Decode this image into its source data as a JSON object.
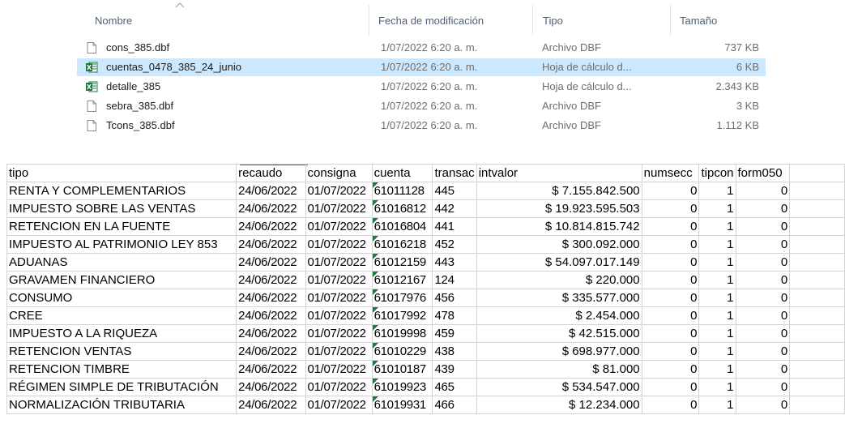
{
  "explorer": {
    "columns": {
      "name": "Nombre",
      "date": "Fecha de modificación",
      "type": "Tipo",
      "size": "Tamaño"
    },
    "files": [
      {
        "name": "cons_385.dbf",
        "date": "1/07/2022 6:20 a. m.",
        "type": "Archivo DBF",
        "size": "737 KB",
        "icon": "blank-file-icon"
      },
      {
        "name": "cuentas_0478_385_24_junio",
        "date": "1/07/2022 6:20 a. m.",
        "type": "Hoja de cálculo d...",
        "size": "6 KB",
        "icon": "excel-file-icon"
      },
      {
        "name": "detalle_385",
        "date": "1/07/2022 6:20 a. m.",
        "type": "Hoja de cálculo d...",
        "size": "2.343 KB",
        "icon": "excel-file-icon"
      },
      {
        "name": "sebra_385.dbf",
        "date": "1/07/2022 6:20 a. m.",
        "type": "Archivo DBF",
        "size": "3 KB",
        "icon": "blank-file-icon"
      },
      {
        "name": "Tcons_385.dbf",
        "date": "1/07/2022 6:20 a. m.",
        "type": "Archivo DBF",
        "size": "1.112 KB",
        "icon": "blank-file-icon"
      }
    ],
    "selected_index": 1
  },
  "sheet": {
    "headers": [
      "tipo",
      "recaudo",
      "consigna",
      "cuenta",
      "transac",
      "intvalor",
      "numsecc",
      "tipcon",
      "form050"
    ],
    "rows": [
      [
        "RENTA Y COMPLEMENTARIOS",
        "24/06/2022",
        "01/07/2022",
        "61011128",
        "445",
        "$ 7.155.842.500",
        "0",
        "1",
        "0"
      ],
      [
        "IMPUESTO SOBRE LAS VENTAS",
        "24/06/2022",
        "01/07/2022",
        "61016812",
        "442",
        "$ 19.923.595.503",
        "0",
        "1",
        "0"
      ],
      [
        "RETENCION EN LA FUENTE",
        "24/06/2022",
        "01/07/2022",
        "61016804",
        "441",
        "$ 10.814.815.742",
        "0",
        "1",
        "0"
      ],
      [
        "IMPUESTO AL PATRIMONIO LEY 853",
        "24/06/2022",
        "01/07/2022",
        "61016218",
        "452",
        "$ 300.092.000",
        "0",
        "1",
        "0"
      ],
      [
        "ADUANAS",
        "24/06/2022",
        "01/07/2022",
        "61012159",
        "443",
        "$ 54.097.017.149",
        "0",
        "1",
        "0"
      ],
      [
        "GRAVAMEN FINANCIERO",
        "24/06/2022",
        "01/07/2022",
        "61012167",
        "124",
        "$ 220.000",
        "0",
        "1",
        "0"
      ],
      [
        "CONSUMO",
        "24/06/2022",
        "01/07/2022",
        "61017976",
        "456",
        "$ 335.577.000",
        "0",
        "1",
        "0"
      ],
      [
        "CREE",
        "24/06/2022",
        "01/07/2022",
        "61017992",
        "478",
        "$ 2.454.000",
        "0",
        "1",
        "0"
      ],
      [
        "IMPUESTO A LA RIQUEZA",
        "24/06/2022",
        "01/07/2022",
        "61019998",
        "459",
        "$ 42.515.000",
        "0",
        "1",
        "0"
      ],
      [
        "RETENCION VENTAS",
        "24/06/2022",
        "01/07/2022",
        "61010229",
        "438",
        "$ 698.977.000",
        "0",
        "1",
        "0"
      ],
      [
        "RETENCION TIMBRE",
        "24/06/2022",
        "01/07/2022",
        "61010187",
        "439",
        "$ 81.000",
        "0",
        "1",
        "0"
      ],
      [
        "RÉGIMEN SIMPLE DE TRIBUTACIÓN",
        "24/06/2022",
        "01/07/2022",
        "61019923",
        "465",
        "$ 534.547.000",
        "0",
        "1",
        "0"
      ],
      [
        "NORMALIZACIÓN TRIBUTARIA",
        "24/06/2022",
        "01/07/2022",
        "61019931",
        "466",
        "$ 12.234.000",
        "0",
        "1",
        "0"
      ]
    ]
  },
  "colors": {
    "selection": "#cce8ff",
    "excel_green": "#217346",
    "header_text": "#4c607a"
  }
}
